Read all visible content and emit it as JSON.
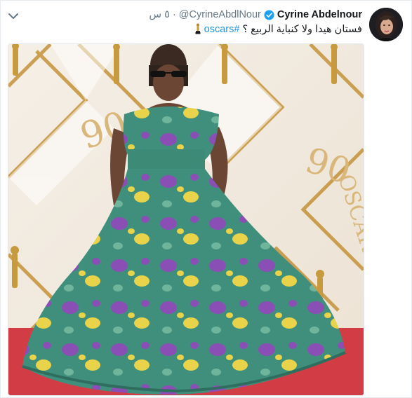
{
  "tweet": {
    "author_name": "Cyrine Abdelnour",
    "handle": "@CyrineAbdlNour",
    "separator": "·",
    "time": "٥ س",
    "text_prefix": "فستان هيدا ولا كنباية الربيع ؟",
    "hashtag": "#oscars",
    "hashtag_color": "#1b95e0"
  },
  "photo": {
    "backdrop_text_a": "90",
    "backdrop_text_b": "90",
    "backdrop_text_c": "OSCARS",
    "dress_colors": [
      "#3f8f7c",
      "#8a4fb4",
      "#e8d34a"
    ],
    "carpet_color": "#d23d45"
  },
  "icons": {
    "menu": "chevron-down-icon",
    "verified": "verified-badge-icon",
    "statue": "oscar-statuette-icon"
  }
}
